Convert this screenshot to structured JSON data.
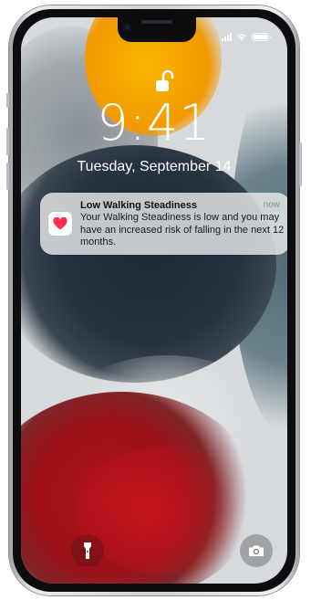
{
  "status_bar": {
    "signal_bars": 4,
    "wifi_icon": "wifi-icon",
    "battery_level": 1.0
  },
  "lock_screen": {
    "lock_icon": "unlocked-padlock-icon",
    "time": "9:41",
    "date": "Tuesday, September 14"
  },
  "notification": {
    "app_icon": "health-heart-icon",
    "title": "Low Walking Steadiness",
    "time": "now",
    "body": "Your Walking Steadiness is low and you may have an increased risk of falling in the next 12 months."
  },
  "bottom_controls": {
    "left_icon": "flashlight-icon",
    "right_icon": "camera-icon"
  },
  "colors": {
    "health_red": "#ff2d55",
    "notification_bg": "#e8eaec"
  }
}
